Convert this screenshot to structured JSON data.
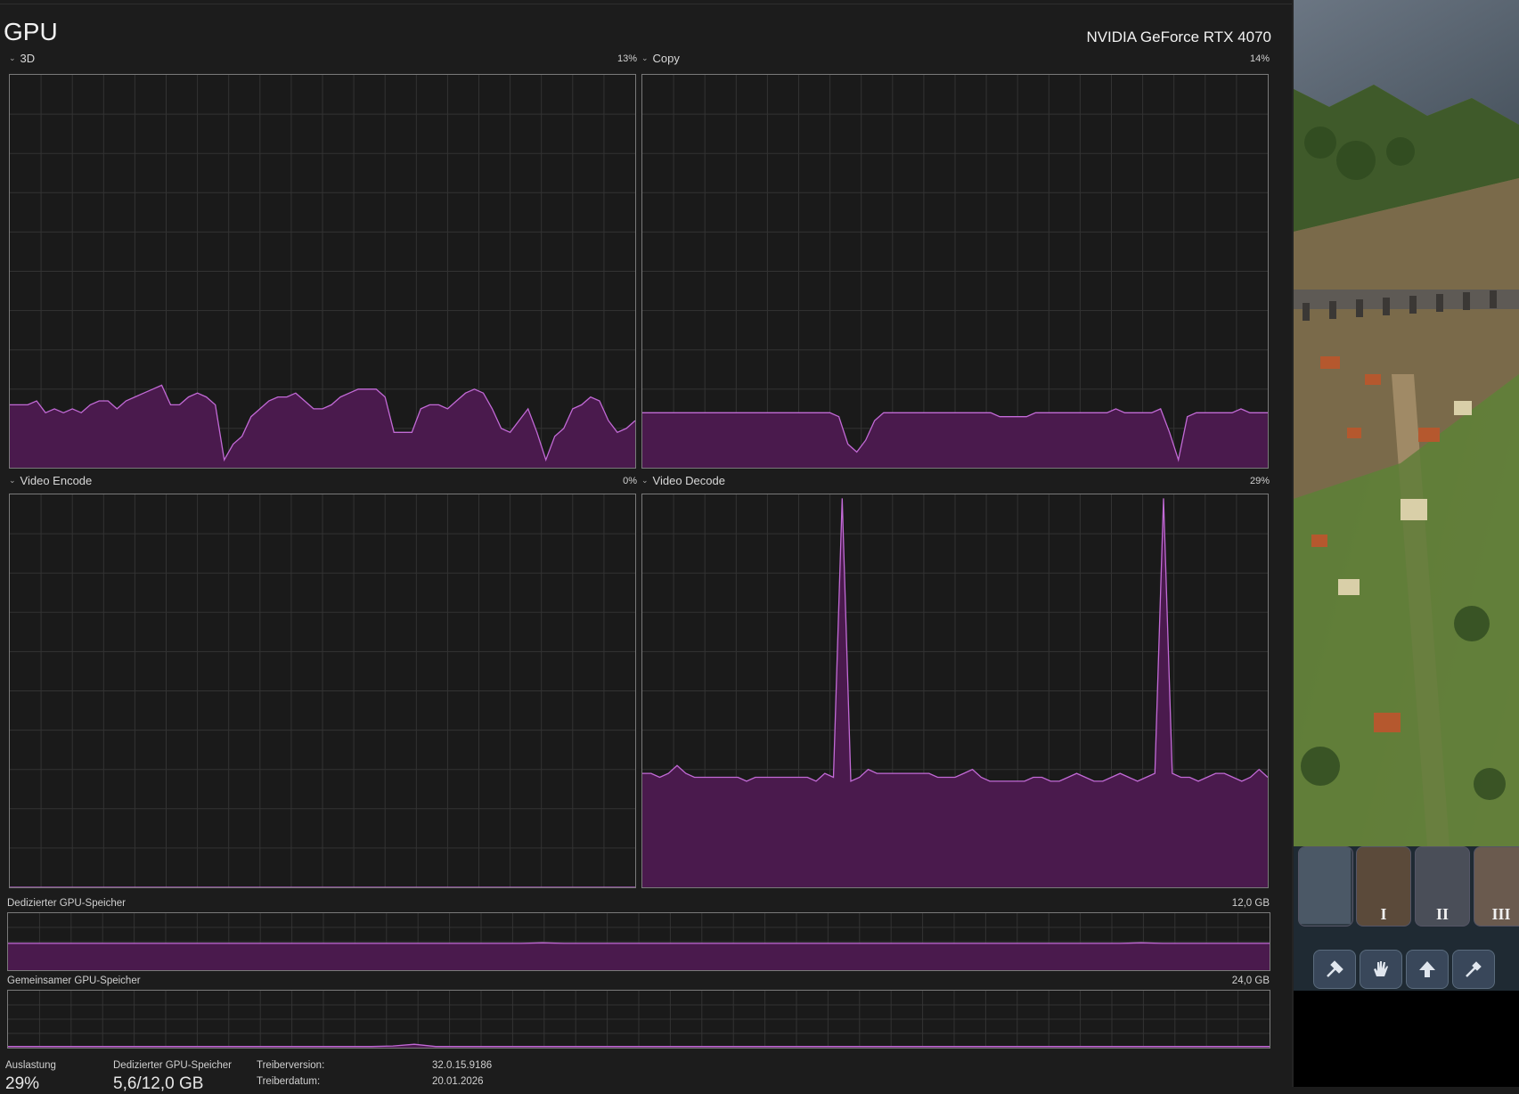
{
  "title": "GPU",
  "gpu_model": "NVIDIA GeForce RTX 4070",
  "engines": [
    {
      "label": "3D",
      "percent": "13%",
      "values": [
        16,
        16,
        16,
        17,
        14,
        15,
        14,
        15,
        14,
        16,
        17,
        17,
        15,
        17,
        18,
        19,
        20,
        21,
        16,
        16,
        18,
        19,
        18,
        16,
        2,
        6,
        8,
        13,
        15,
        17,
        18,
        18,
        19,
        17,
        15,
        15,
        16,
        18,
        19,
        20,
        20,
        20,
        18,
        9,
        9,
        9,
        15,
        16,
        16,
        15,
        17,
        19,
        20,
        19,
        15,
        10,
        9,
        12,
        15,
        9,
        2,
        8,
        10,
        15,
        16,
        18,
        17,
        12,
        9,
        10,
        12
      ]
    },
    {
      "label": "Copy",
      "percent": "14%",
      "values": [
        14,
        14,
        14,
        14,
        14,
        14,
        14,
        14,
        14,
        14,
        14,
        14,
        14,
        14,
        14,
        14,
        14,
        14,
        14,
        14,
        14,
        14,
        13,
        6,
        4,
        7,
        12,
        14,
        14,
        14,
        14,
        14,
        14,
        14,
        14,
        14,
        14,
        14,
        14,
        14,
        13,
        13,
        13,
        13,
        14,
        14,
        14,
        14,
        14,
        14,
        14,
        14,
        14,
        15,
        14,
        14,
        14,
        14,
        15,
        9,
        2,
        13,
        14,
        14,
        14,
        14,
        14,
        15,
        14,
        14,
        14
      ]
    },
    {
      "label": "Video Encode",
      "percent": "0%",
      "values": [
        0,
        0,
        0,
        0,
        0,
        0,
        0,
        0,
        0,
        0,
        0,
        0,
        0,
        0,
        0,
        0,
        0,
        0,
        0,
        0,
        0,
        0,
        0,
        0,
        0,
        0,
        0,
        0,
        0,
        0,
        0,
        0,
        0,
        0,
        0,
        0,
        0,
        0,
        0,
        0,
        0,
        0,
        0,
        0,
        0,
        0,
        0,
        0,
        0,
        0,
        0,
        0,
        0,
        0,
        0,
        0,
        0,
        0,
        0,
        0,
        0,
        0,
        0,
        0,
        0,
        0,
        0,
        0,
        0,
        0,
        0
      ]
    },
    {
      "label": "Video Decode",
      "percent": "29%",
      "values": [
        29,
        29,
        28,
        29,
        31,
        29,
        28,
        28,
        28,
        28,
        28,
        28,
        27,
        28,
        28,
        28,
        28,
        28,
        28,
        28,
        27,
        29,
        28,
        27,
        27,
        28,
        30,
        29,
        29,
        29,
        29,
        29,
        29,
        29,
        28,
        28,
        28,
        29,
        30,
        28,
        27,
        27,
        27,
        27,
        27,
        28,
        28,
        27,
        27,
        28,
        29,
        28,
        27,
        27,
        28,
        29,
        28,
        27,
        28,
        29,
        30,
        29,
        28,
        28,
        27,
        28,
        29,
        29,
        28,
        27,
        28,
        30,
        28
      ]
    }
  ],
  "decode_spikes": [
    {
      "index": 23,
      "value": 99
    },
    {
      "index": 60,
      "value": 99
    }
  ],
  "dedicated_memory": {
    "label": "Dedizierter GPU-Speicher",
    "max": "12,0 GB",
    "fraction": 0.47
  },
  "shared_memory": {
    "label": "Gemeinsamer GPU-Speicher",
    "max": "24,0 GB",
    "fraction": 0.02
  },
  "stats": {
    "utilization_label": "Auslastung",
    "utilization_value": "29%",
    "dedicated_label": "Dedizierter GPU-Speicher",
    "dedicated_value": "5,6/12,0 GB",
    "driver_version_label": "Treiberversion:",
    "driver_version_value": "32.0.15.9186",
    "driver_date_label": "Treiberdatum:",
    "driver_date_value": "20.01.2026"
  },
  "game": {
    "portraits": [
      "I",
      "II",
      "III"
    ],
    "tools": [
      "hammer-icon",
      "hand-icon",
      "arrow-up-icon",
      "pipette-icon"
    ]
  },
  "colors": {
    "line": "#c26ad6",
    "fill": "#4a1a4d",
    "grid": "#333333"
  }
}
